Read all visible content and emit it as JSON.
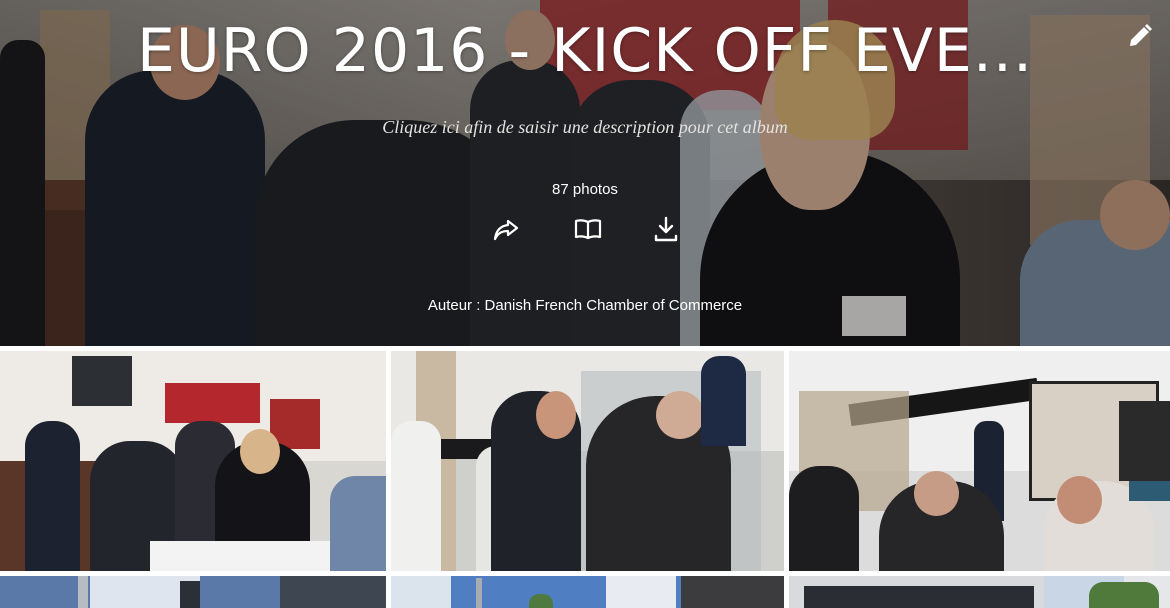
{
  "album": {
    "title": "EURO 2016 - KICK OFF EVE...",
    "description": "Cliquez ici afin de saisir une description pour cet album",
    "photo_count": "87 photos",
    "author": "Auteur : Danish French Chamber of Commerce"
  },
  "actions": [
    {
      "name": "share",
      "icon": "share-arrow-icon"
    },
    {
      "name": "slideshow",
      "icon": "open-book-icon"
    },
    {
      "name": "download",
      "icon": "download-icon"
    }
  ],
  "edit": {
    "icon": "pencil-icon"
  },
  "photos": [
    {
      "id": "photo-1",
      "scene": "lobby with people and Wall of Fame sign"
    },
    {
      "id": "photo-2",
      "scene": "staircase with cameraman and guests"
    },
    {
      "id": "photo-3",
      "scene": "atrium with mural and guests"
    },
    {
      "id": "photo-4",
      "scene": "building exterior"
    },
    {
      "id": "photo-5",
      "scene": "outdoor sky and trees"
    },
    {
      "id": "photo-6",
      "scene": "bus exterior"
    }
  ],
  "colors": {
    "title_text": "#ffffff",
    "overlay": "rgba(0,0,0,0.28)",
    "accent_red": "#b3272d"
  }
}
